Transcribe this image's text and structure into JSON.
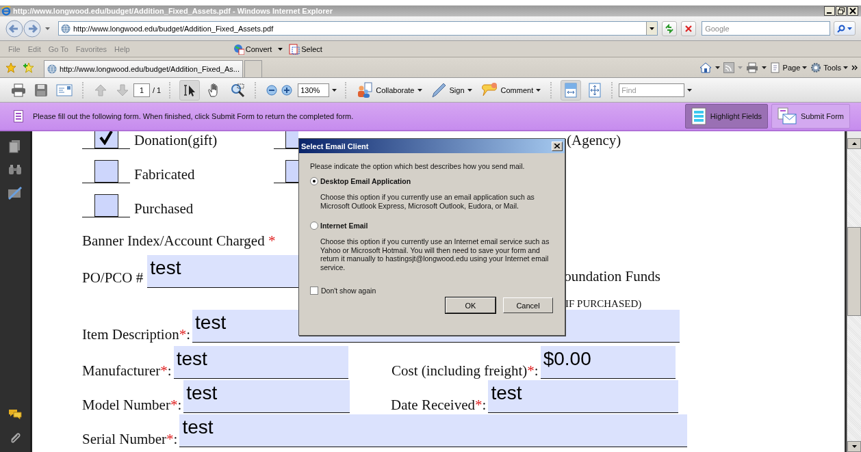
{
  "window": {
    "title": "http://www.longwood.edu/budget/Addition_Fixed_Assets.pdf - Windows Internet Explorer"
  },
  "address_bar": {
    "url": "http://www.longwood.edu/budget/Addition_Fixed_Assets.pdf",
    "search_placeholder": "Google"
  },
  "menu_bar": {
    "items": [
      "File",
      "Edit",
      "Go To",
      "Favorites",
      "Help"
    ],
    "tools": [
      "Convert",
      "Select"
    ]
  },
  "tabs": [
    {
      "label": "http://www.longwood.edu/budget/Addition_Fixed_As...",
      "selected": true
    }
  ],
  "command_bar": [
    "Page",
    "Tools"
  ],
  "pdf_toolbar": {
    "page": "1",
    "page_count": "/ 1",
    "zoom": "130%",
    "buttons": [
      "Collaborate",
      "Sign",
      "Comment"
    ],
    "find_placeholder": "Find"
  },
  "form_bar": {
    "message": "Please fill out the following form. When finished, click Submit Form to return the completed form.",
    "buttons": [
      {
        "label": "Highlight Fields",
        "kind": "highlight",
        "on": true
      },
      {
        "label": "Submit Form",
        "kind": "submit",
        "on": false
      }
    ]
  },
  "document": {
    "checkbox_rows": [
      {
        "label": "Donation(gift)",
        "checked": true,
        "second": {
          "checked": false,
          "label": "(Agency)"
        }
      },
      {
        "label": "Fabricated",
        "checked": false,
        "second": {
          "checked": false
        }
      },
      {
        "label": "Purchased",
        "checked": false
      }
    ],
    "banner": {
      "label": "Banner Index/Account Charged",
      "mark": "*"
    },
    "po": {
      "label": "PO/PCO #",
      "value": "test",
      "trailing_text": "oundation Funds"
    },
    "note": "IF PURCHASED)",
    "field_rows": [
      [
        {
          "label": "Item Description",
          "mark": "*",
          "punct": ":",
          "value": "test"
        }
      ],
      [
        {
          "label": "Manufacturer",
          "mark": "*",
          "punct": ":",
          "value": "test"
        },
        {
          "label": "Cost (including freight)",
          "mark": "*",
          "punct": ":",
          "value": "$0.00"
        }
      ],
      [
        {
          "label": "Model Number",
          "mark": "*",
          "punct": ":",
          "value": "test"
        },
        {
          "label": "Date Received",
          "mark": "*",
          "punct": ":",
          "value": "test"
        }
      ],
      [
        {
          "label": "Serial Number",
          "mark": "*",
          "punct": ":",
          "value": "test"
        }
      ]
    ]
  },
  "dialog": {
    "title": "Select Email Client",
    "prompt": "Please indicate the option which best describes how you send mail.",
    "options": [
      {
        "label": "Desktop Email Application",
        "description": "Choose this option if you currently use an email application such as Microsoft Outlook Express, Microsoft Outlook, Eudora, or Mail.",
        "selected": true
      },
      {
        "label": "Internet Email",
        "description": "Choose this option if you currently use an Internet email service such as Yahoo or Microsoft Hotmail. You will then need to save your form and return it manually to hastingsjt@longwood.edu using your Internet email service.",
        "selected": false
      }
    ],
    "dont_show_again": {
      "label": "Don't show again",
      "checked": false
    },
    "buttons": [
      "OK",
      "Cancel"
    ]
  }
}
